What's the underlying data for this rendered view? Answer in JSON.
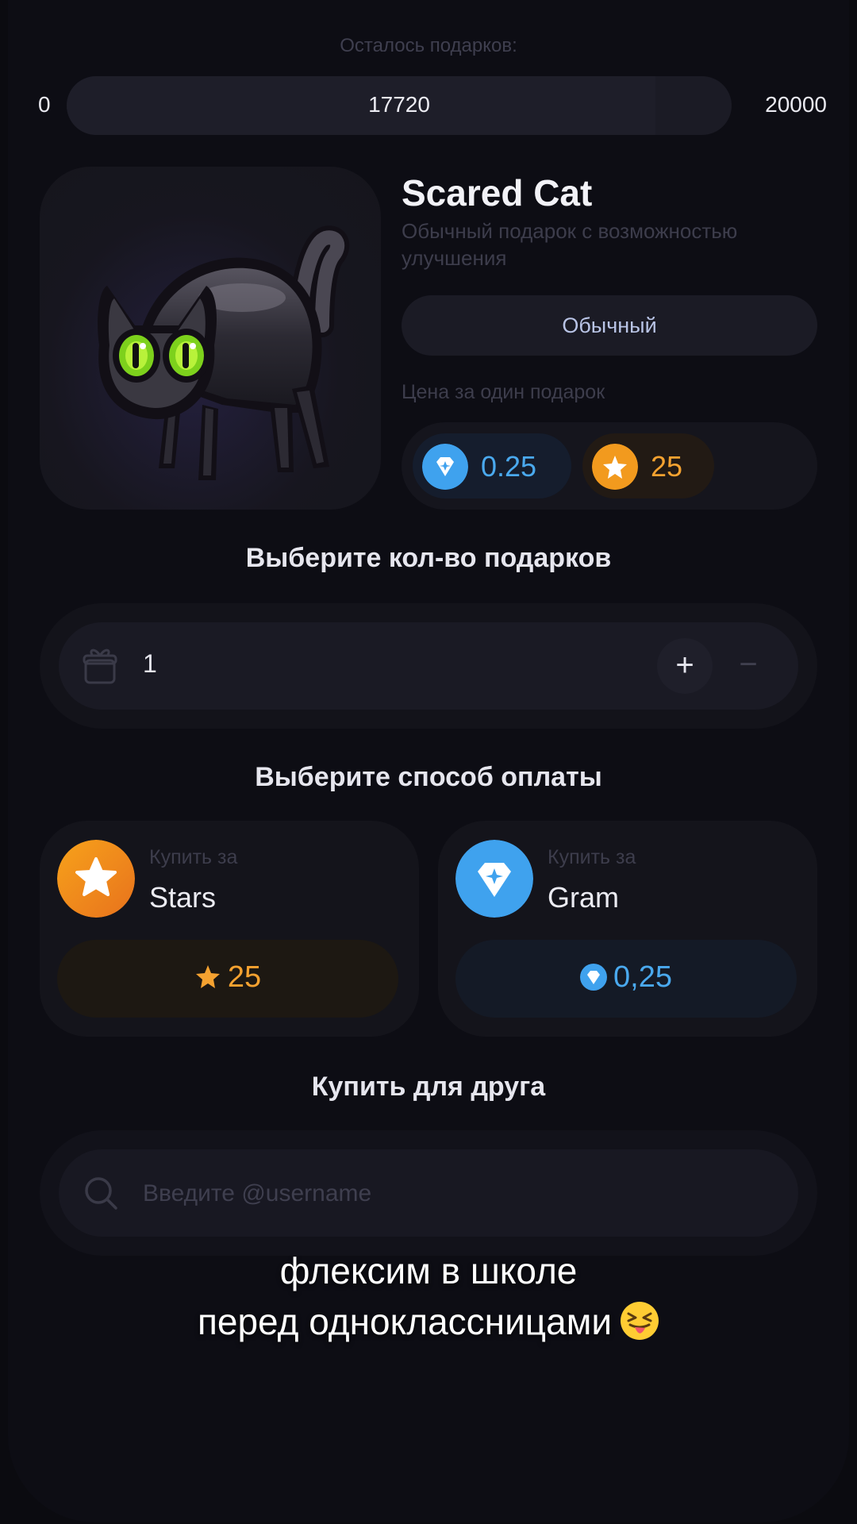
{
  "supply": {
    "title": "Осталось подарков:",
    "min": "0",
    "current": "17720",
    "max": "20000",
    "fill_fraction": 0.886
  },
  "gift": {
    "name": "Scared Cat",
    "description": "Обычный подарок с возможностью улучшения",
    "rarity": "Обычный",
    "price_label": "Цена за один подарок",
    "price_ton": "0.25",
    "price_stars": "25",
    "image_icon": "scared-black-cat"
  },
  "quantity": {
    "title": "Выберите кол-во подарков",
    "value": "1",
    "plus": "+",
    "minus": "−",
    "icon": "gift-box-icon"
  },
  "payment": {
    "title": "Выберите способ оплаты",
    "stars": {
      "sub": "Купить за",
      "name": "Stars",
      "amount": "25",
      "icon": "star-icon"
    },
    "gram": {
      "sub": "Купить за",
      "name": "Gram",
      "amount": "0,25",
      "icon": "diamond-icon"
    }
  },
  "friend": {
    "title": "Купить для друга",
    "placeholder": "Введите @username",
    "icon": "search-icon"
  },
  "caption": {
    "line1": "флексим в школе",
    "line2": "перед одноклассницами",
    "emoji": "squinting-face-with-tongue"
  },
  "colors": {
    "background": "#0d0d14",
    "ton_blue": "#3fa2ee",
    "star_orange": "#f5a230"
  }
}
